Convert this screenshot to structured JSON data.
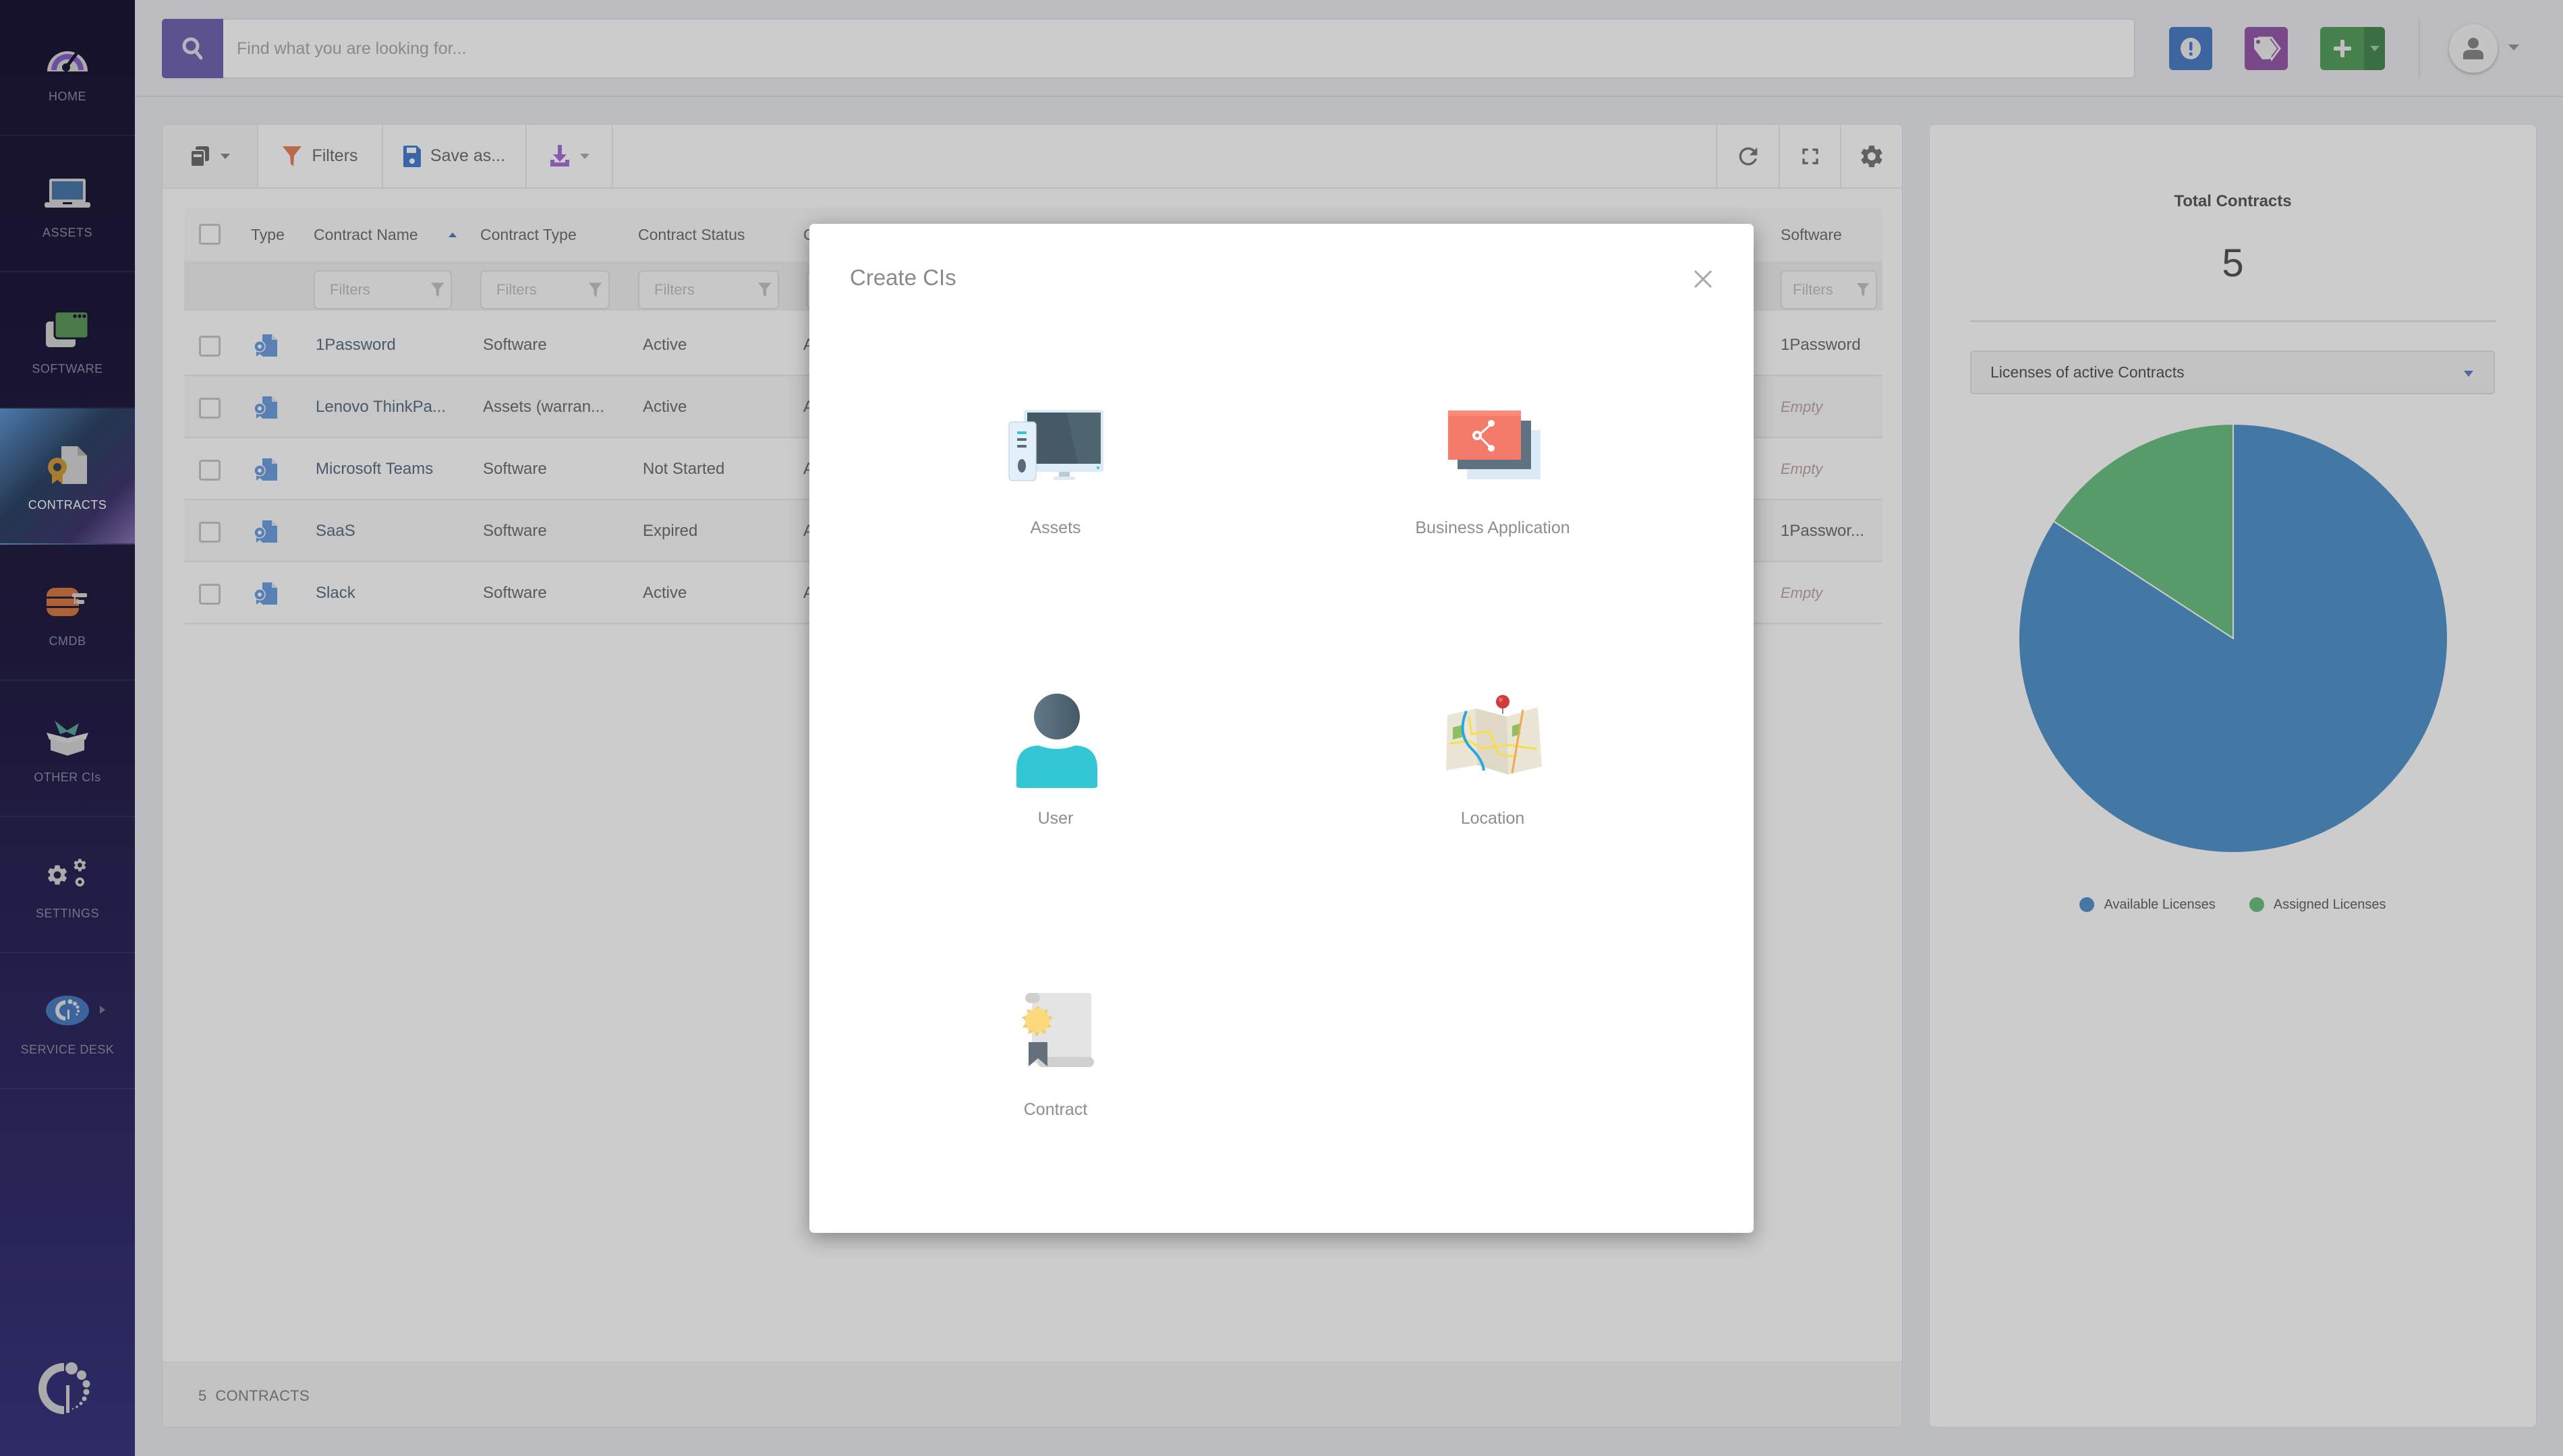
{
  "sidebar": {
    "items": [
      {
        "label": "HOME",
        "icon": "gauge-icon"
      },
      {
        "label": "ASSETS",
        "icon": "laptop-icon"
      },
      {
        "label": "SOFTWARE",
        "icon": "software-windows-icon"
      },
      {
        "label": "CONTRACTS",
        "icon": "contract-document-icon",
        "active": true
      },
      {
        "label": "CMDB",
        "icon": "database-icon"
      },
      {
        "label": "OTHER CIs",
        "icon": "open-box-icon"
      },
      {
        "label": "SETTINGS",
        "icon": "gears-icon"
      },
      {
        "label": "SERVICE DESK",
        "icon": "service-desk-logo-icon"
      }
    ],
    "logo": "brand-logo-icon"
  },
  "header": {
    "search_placeholder": "Find what you are looking for...",
    "actions": [
      {
        "name": "alerts",
        "icon": "exclamation-icon",
        "color": "#4d80c8"
      },
      {
        "name": "tags",
        "icon": "tags-icon",
        "color": "#985aaa"
      },
      {
        "name": "create",
        "icon": "plus-icon",
        "color": "#58a05f"
      }
    ],
    "user_icon": "user-avatar-icon"
  },
  "toolbar": {
    "filters_label": "Filters",
    "save_as_label": "Save as...",
    "colors": {
      "filters": "#e6855f",
      "save": "#4880d0",
      "export": "#ad71dc"
    }
  },
  "table": {
    "columns": [
      {
        "label": "Type"
      },
      {
        "label": "Contract Name",
        "sort": "ascending"
      },
      {
        "label": "Contract Type"
      },
      {
        "label": "Contract Status"
      },
      {
        "label": "C"
      },
      {
        "label": "Software"
      }
    ],
    "filter_placeholder": "Filters",
    "rows": [
      {
        "name": "1Password",
        "contract_type": "Software",
        "status": "Active",
        "col5": "A",
        "software": "1Password"
      },
      {
        "name": "Lenovo ThinkPa...",
        "contract_type": "Assets (warran...",
        "status": "Active",
        "col5": "A",
        "software": "Empty"
      },
      {
        "name": "Microsoft Teams",
        "contract_type": "Software",
        "status": "Not Started",
        "col5": "A",
        "software": "Empty"
      },
      {
        "name": "SaaS",
        "contract_type": "Software",
        "status": "Expired",
        "col5": "A",
        "software": "1Passwor..."
      },
      {
        "name": "Slack",
        "contract_type": "Software",
        "status": "Active",
        "col5": "A",
        "software": "Empty"
      }
    ]
  },
  "footer": {
    "count": "5",
    "label": "CONTRACTS"
  },
  "summary": {
    "title": "Total Contracts",
    "value": "5",
    "chart_selector": "Licenses of active Contracts"
  },
  "chart_data": {
    "type": "pie",
    "title": "Licenses of active Contracts",
    "categories": [
      "Available Licenses",
      "Assigned Licenses"
    ],
    "values": [
      84.2,
      15.8
    ],
    "unit": "percent",
    "colors": [
      "#5496cf",
      "#6dc286"
    ],
    "legend": "bottom-center"
  },
  "modal": {
    "title": "Create CIs",
    "items": [
      {
        "label": "Assets",
        "icon": "computer-icon"
      },
      {
        "label": "Business Application",
        "icon": "business-application-icon"
      },
      {
        "label": "User",
        "icon": "user-icon"
      },
      {
        "label": "Location",
        "icon": "map-location-icon"
      },
      {
        "label": "Contract",
        "icon": "certificate-icon"
      }
    ]
  }
}
